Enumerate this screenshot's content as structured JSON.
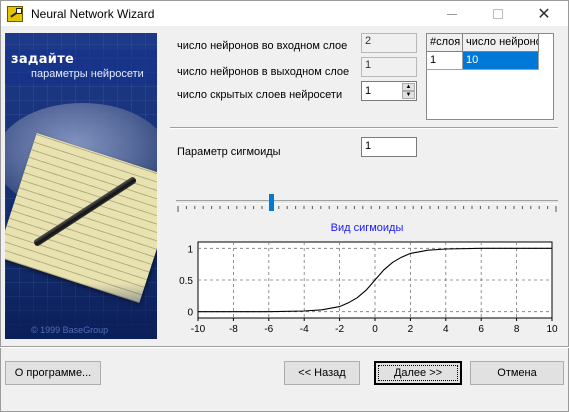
{
  "window": {
    "title": "Neural Network Wizard",
    "close_glyph": "✕"
  },
  "banner": {
    "title": "задайте",
    "subtitle": "параметры нейросети",
    "copyright": "© 1999 BaseGroup"
  },
  "form": {
    "input_neurons_label": "число нейронов во входном слое",
    "input_neurons_value": "2",
    "output_neurons_label": "число нейронов в выходном слое",
    "output_neurons_value": "1",
    "hidden_layers_label": "число скрытых слоев нейросети",
    "hidden_layers_value": "1",
    "sigmoid_param_label": "Параметр сигмоиды",
    "sigmoid_param_value": "1"
  },
  "layers_grid": {
    "headers": [
      "#слоя",
      "число нейронов"
    ],
    "rows": [
      [
        "1",
        "10"
      ]
    ]
  },
  "slider": {
    "value_fraction": 0.25
  },
  "chart_data": {
    "type": "line",
    "title": "Вид сигмоиды",
    "xlabel": "",
    "ylabel": "",
    "xlim": [
      -10,
      10
    ],
    "ylim": [
      0,
      1
    ],
    "x_ticks": [
      -10,
      -8,
      -6,
      -4,
      -2,
      0,
      2,
      4,
      6,
      8,
      10
    ],
    "y_ticks": [
      0,
      0.5,
      1
    ],
    "y_tick_labels": [
      "0",
      "0.5",
      "1"
    ],
    "grid": true,
    "series": [
      {
        "x": [
          -10,
          -8,
          -6,
          -4,
          -3,
          -2,
          -1.5,
          -1,
          -0.5,
          0,
          0.5,
          1,
          1.5,
          2,
          3,
          4,
          6,
          8,
          10
        ],
        "y": [
          0,
          0,
          0,
          0.01,
          0.03,
          0.08,
          0.14,
          0.22,
          0.34,
          0.5,
          0.66,
          0.78,
          0.86,
          0.92,
          0.97,
          0.99,
          1,
          1,
          1
        ]
      }
    ]
  },
  "buttons": {
    "about": "О программе...",
    "back": "<< Назад",
    "next": "Далее >>",
    "cancel": "Отмена"
  },
  "colors": {
    "accent": "#0078d7",
    "chart_title": "#1a1aff",
    "banner_bg": "#173276"
  }
}
